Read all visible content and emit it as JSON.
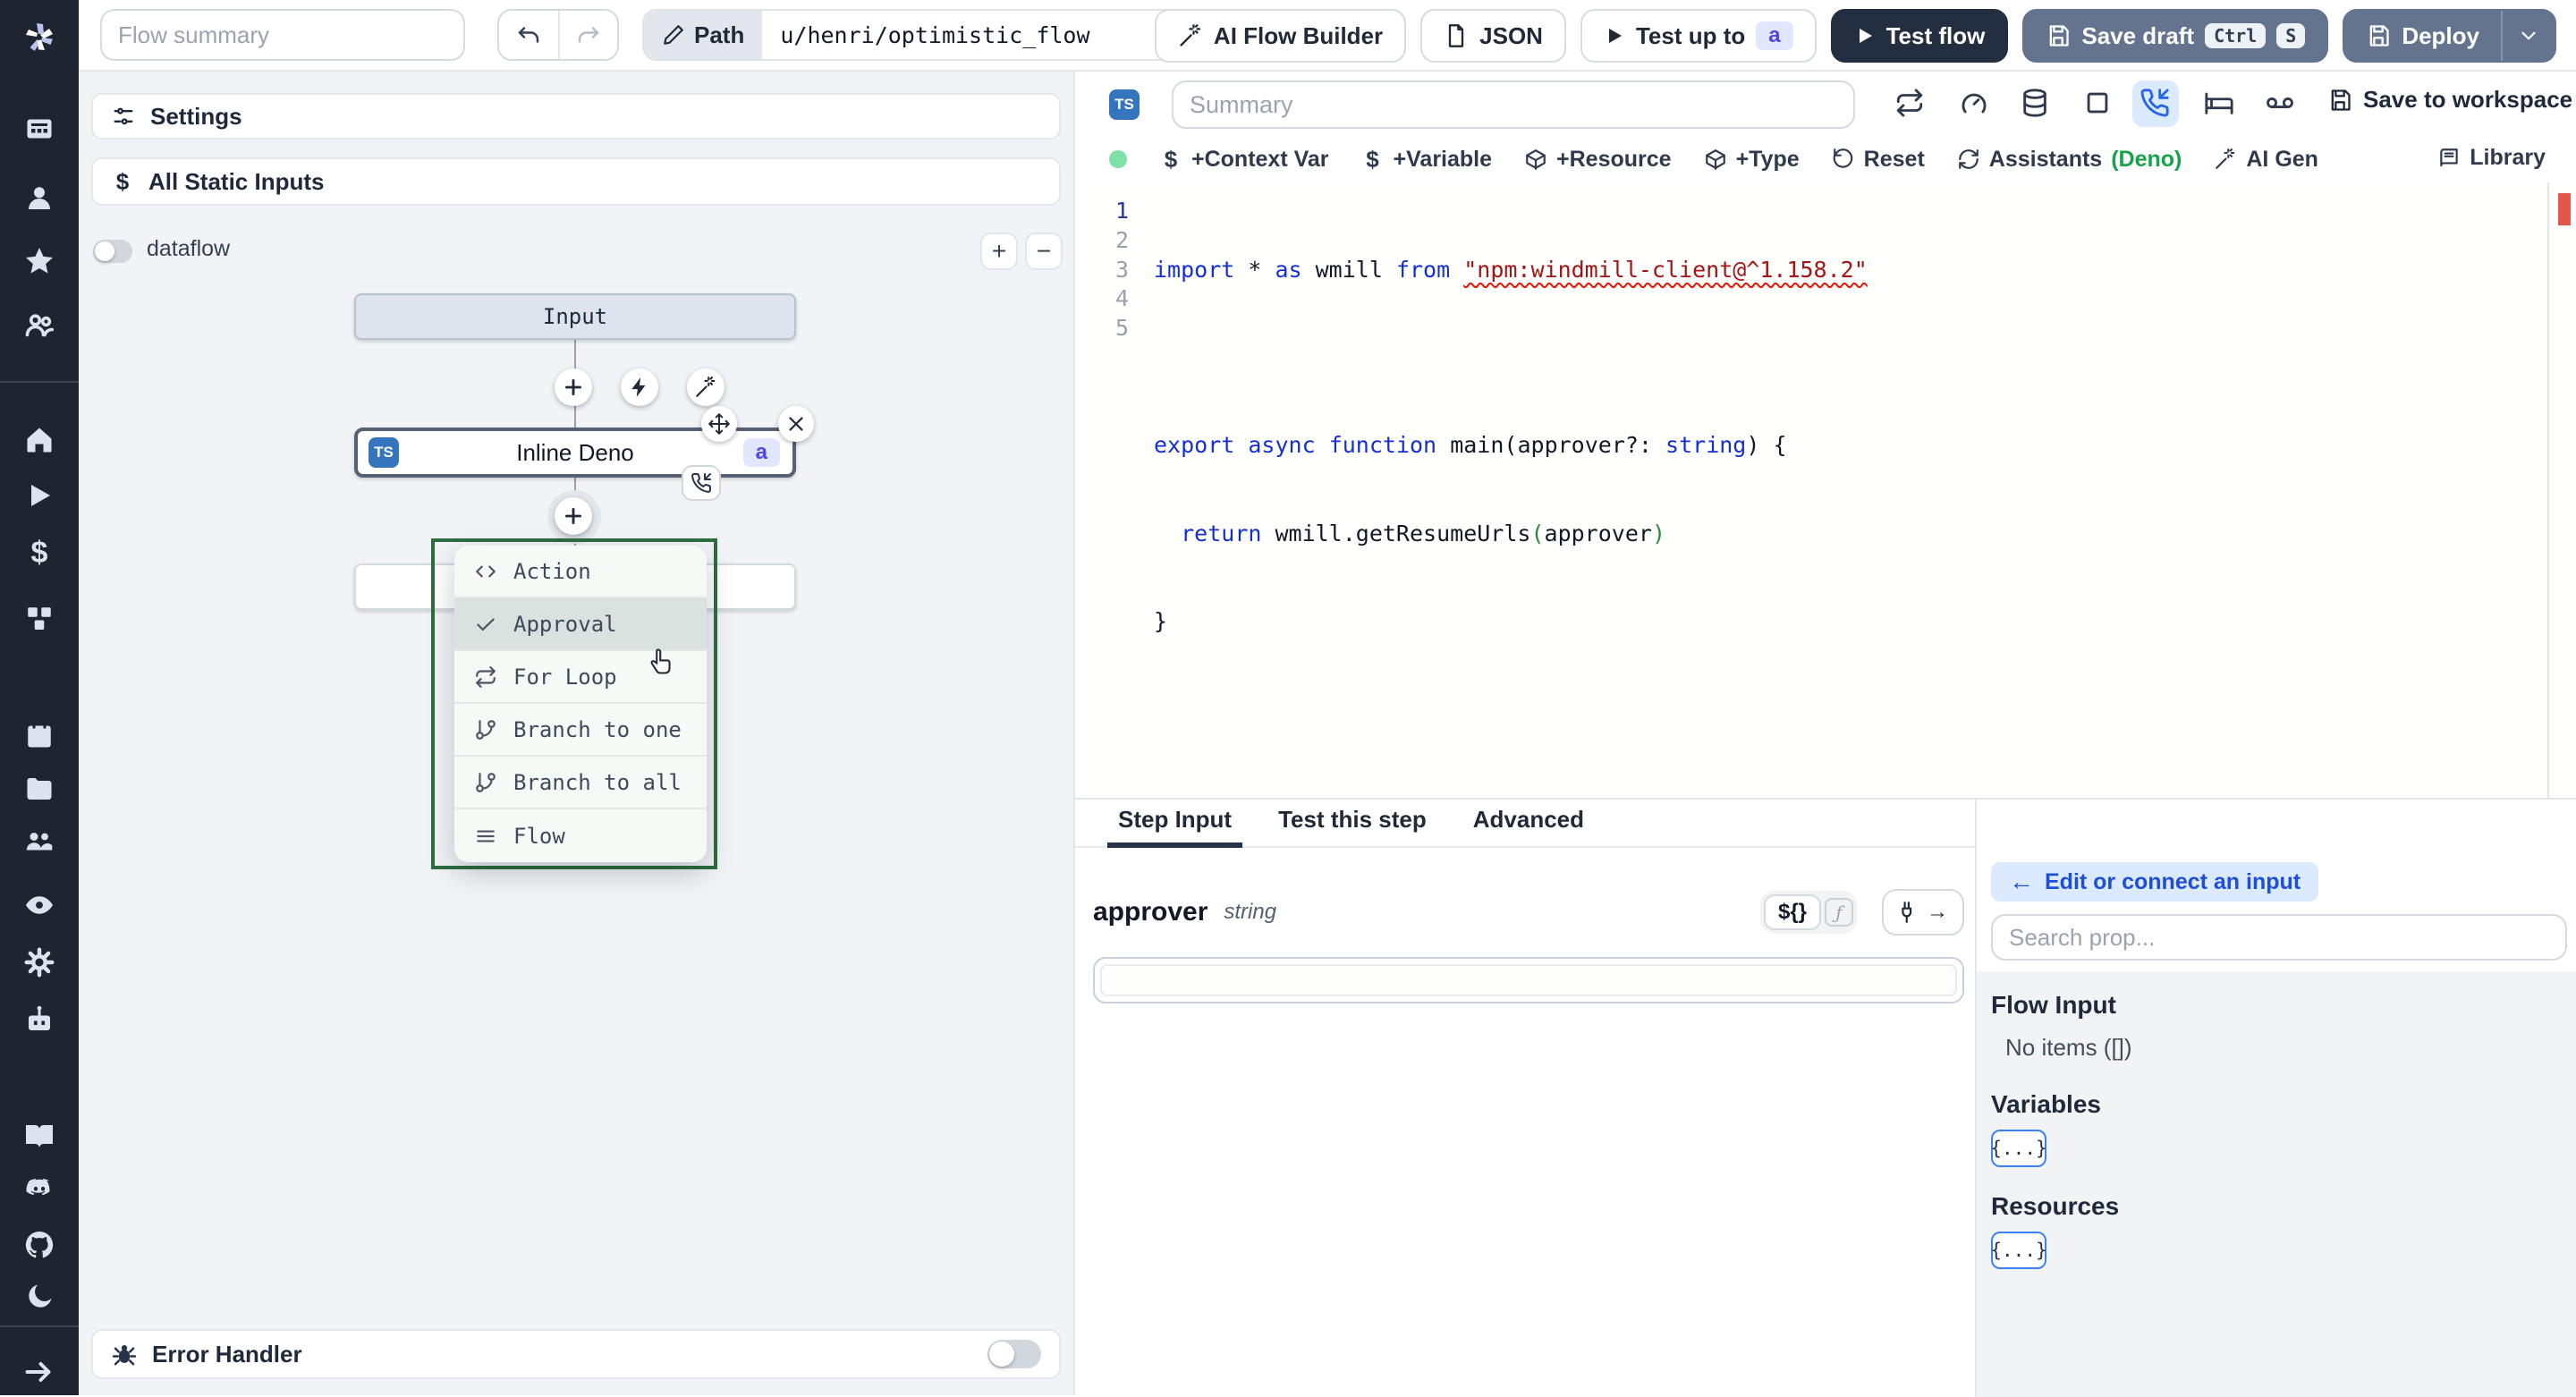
{
  "topbar": {
    "flow_summary_placeholder": "Flow summary",
    "path_label": "Path",
    "path_value": "u/henri/optimistic_flow",
    "ai_flow_builder": "AI Flow Builder",
    "json_label": "JSON",
    "test_up_to": "Test up to",
    "test_up_to_badge": "a",
    "test_flow": "Test flow",
    "save_draft": "Save draft",
    "kbd_ctrl": "Ctrl",
    "kbd_s": "S",
    "deploy": "Deploy"
  },
  "sidebar": {
    "icons": [
      "windmill-logo",
      "apps",
      "user",
      "favorites",
      "groups",
      "home",
      "runs",
      "variables",
      "resources",
      "schedules",
      "folders",
      "workers",
      "audit-logs",
      "settings",
      "ai-assistant",
      "docs",
      "discord",
      "github",
      "dark-mode",
      "expand-sidebar"
    ]
  },
  "flow_panel": {
    "settings": "Settings",
    "all_static_inputs": "All Static Inputs",
    "dataflow": "dataflow",
    "zoom_in": "+",
    "zoom_out": "−",
    "input_node": "Input",
    "deno_node": {
      "badge": "TS",
      "label": "Inline Deno",
      "suffix_badge": "a"
    },
    "menu": {
      "items": [
        {
          "label": "Action",
          "icon": "code-icon"
        },
        {
          "label": "Approval",
          "icon": "check-icon"
        },
        {
          "label": "For Loop",
          "icon": "repeat-icon"
        },
        {
          "label": "Branch to one",
          "icon": "git-branch-icon"
        },
        {
          "label": "Branch to all",
          "icon": "git-branch-icon"
        },
        {
          "label": "Flow",
          "icon": "menu-lines-icon"
        }
      ]
    },
    "error_handler": "Error Handler"
  },
  "editor": {
    "lang_badge": "TS",
    "summary_placeholder": "Summary",
    "save_to_workspace": "Save to workspace",
    "status_color": "#7ee2a8",
    "actions": {
      "dollar": "$",
      "context_var": "+Context Var",
      "variable": "+Variable",
      "resource": "+Resource",
      "type": "+Type",
      "reset": "Reset",
      "assistants": "Assistants",
      "assistants_lang": "(Deno)",
      "ai_gen": "AI Gen",
      "library": "Library"
    },
    "code": {
      "line_numbers": [
        "1",
        "2",
        "3",
        "4",
        "5"
      ],
      "line1": [
        "import",
        " * ",
        "as",
        " wmill ",
        "from",
        " ",
        "\"npm:windmill-client@^1.158.2\""
      ],
      "line3": [
        "export",
        " ",
        "async",
        " ",
        "function",
        " ",
        "main",
        "(",
        "approver?: ",
        "string",
        ")",
        " {"
      ],
      "line4": [
        "  ",
        "return",
        " wmill.getResumeUrls",
        "(",
        "approver",
        ")"
      ],
      "line5": [
        "}"
      ]
    }
  },
  "step_panel": {
    "tabs": [
      "Step Input",
      "Test this step",
      "Advanced"
    ],
    "field_name": "approver",
    "field_type": "string",
    "expr_toggle": "${}",
    "fn_toggle": "ƒ",
    "plug_arrow": "→"
  },
  "connect_panel": {
    "back_arrow": "←",
    "edit_button": "Edit or connect an input",
    "search_placeholder": "Search prop...",
    "flow_input_title": "Flow Input",
    "flow_input_empty": "No items ([])",
    "variables_title": "Variables",
    "resources_title": "Resources",
    "object_chip": "{...}"
  },
  "colors": {
    "accent_blue": "#2563eb",
    "ts_badge_blue": "#3575be",
    "badge_indigo_bg": "#e0e7ff",
    "menu_border_green": "#2c6e3f",
    "error_marker_red": "#e45649",
    "sidebar_dark": "#1e2430"
  }
}
